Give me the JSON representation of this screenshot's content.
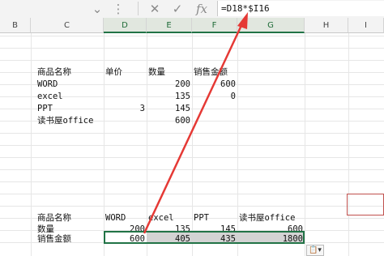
{
  "formula_bar": {
    "chevron": "⌄",
    "more": "⋮",
    "cancel": "✕",
    "enter": "✓",
    "fx": "fx",
    "formula": "=D18*$I16"
  },
  "columns": [
    "B",
    "C",
    "D",
    "E",
    "F",
    "G",
    "H",
    "I"
  ],
  "top_table": {
    "headers": [
      "商品名称",
      "单价",
      "数量",
      "销售金额"
    ],
    "rows": [
      {
        "name": "WORD",
        "price": "",
        "qty": "200",
        "sales": "600"
      },
      {
        "name": "excel",
        "price": "",
        "qty": "135",
        "sales": "0"
      },
      {
        "name": "PPT",
        "price": "3",
        "qty": "145",
        "sales": ""
      },
      {
        "name": "读书屋office",
        "price": "",
        "qty": "600",
        "sales": ""
      }
    ]
  },
  "bottom_table": {
    "header_row": [
      "商品名称",
      "WORD",
      "excel",
      "PPT",
      "读书屋office"
    ],
    "qty_row": {
      "label": "数量",
      "values": [
        "200",
        "135",
        "145",
        "600"
      ]
    },
    "sales_row": {
      "label": "销售金额",
      "values": [
        "600",
        "405",
        "435",
        "1800"
      ]
    }
  },
  "paste_options_icon": "📋▾",
  "colors": {
    "accent": "#217346",
    "arrow": "#e53935"
  }
}
